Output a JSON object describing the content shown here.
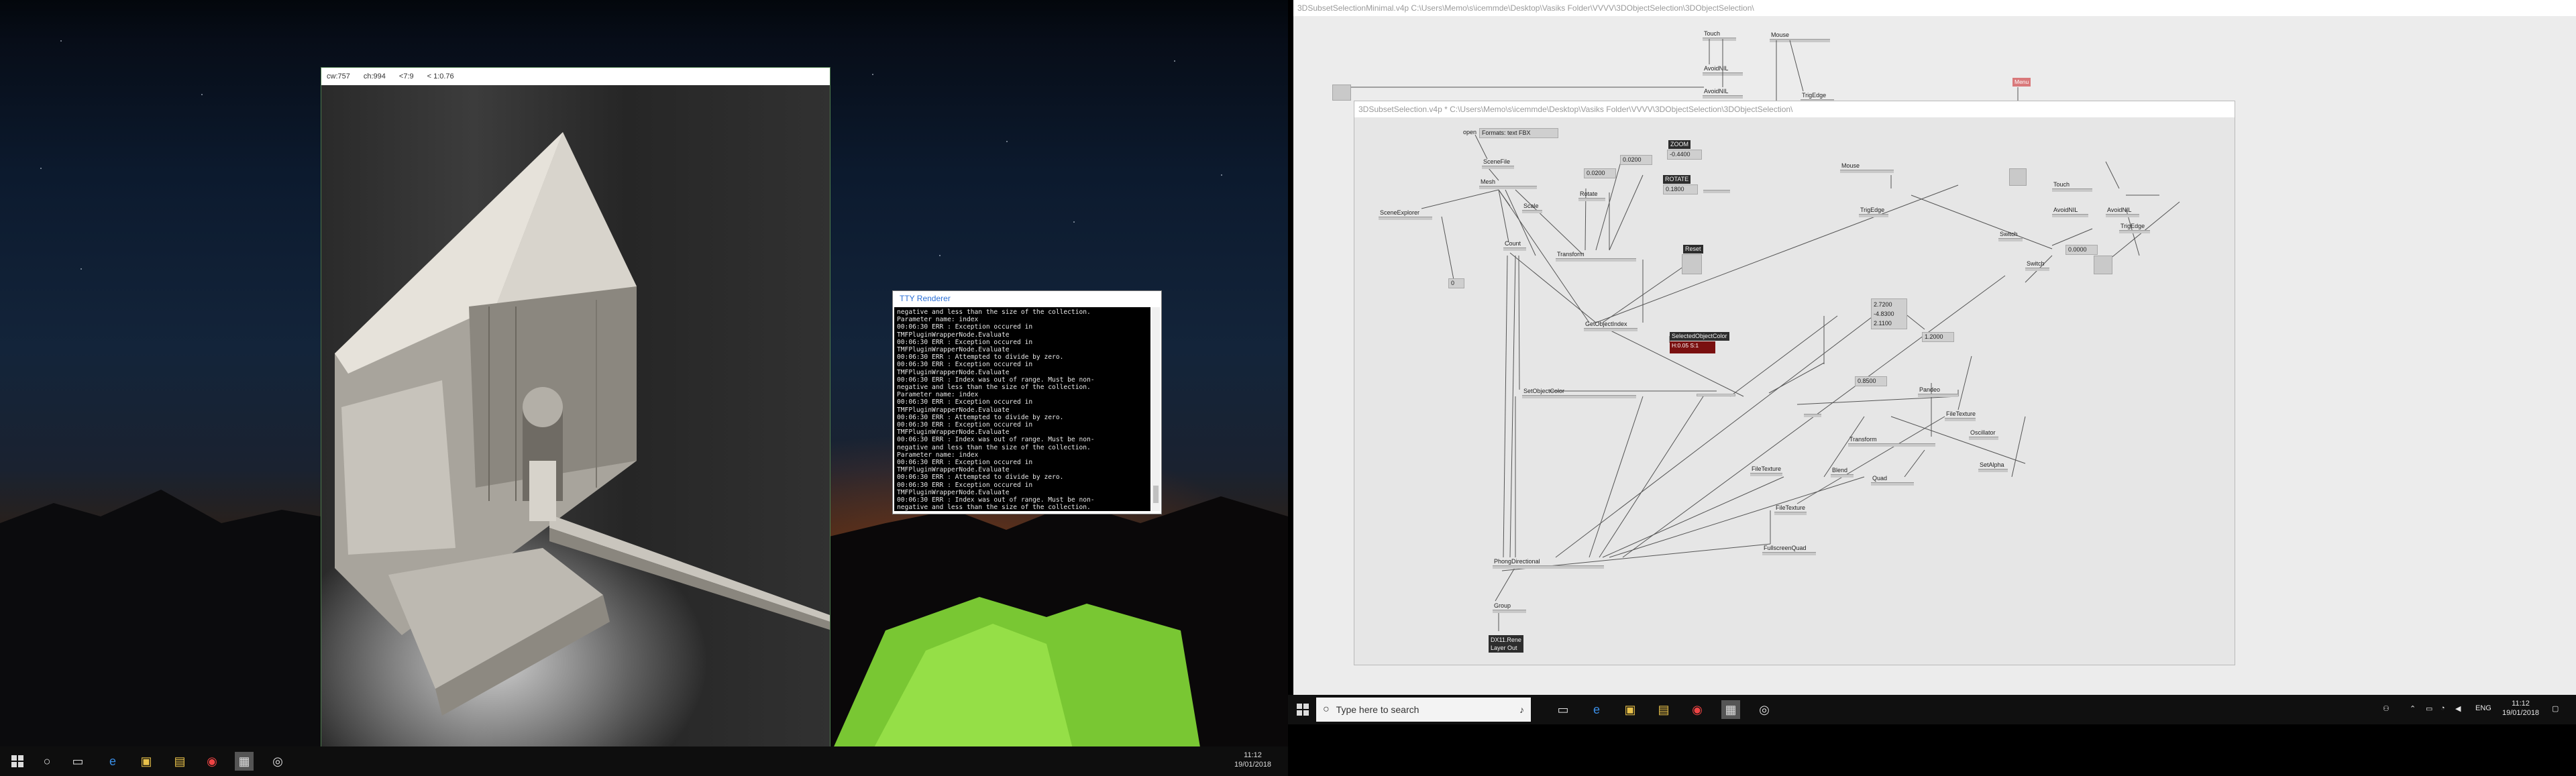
{
  "left_monitor": {
    "renderer": {
      "title_fields": [
        "cw:757",
        "ch:994",
        "<7:9",
        "< 1:0.76"
      ]
    },
    "tty_window": {
      "title": "TTY Renderer",
      "log": "negative and less than the size of the collection.\nParameter name: index\n00:06:30 ERR : Exception occured in\nTMFPluginWrapperNode.Evaluate\n00:06:30 ERR : Exception occured in\nTMFPluginWrapperNode.Evaluate\n00:06:30 ERR : Attempted to divide by zero.\n00:06:30 ERR : Exception occured in\nTMFPluginWrapperNode.Evaluate\n00:06:30 ERR : Index was out of range. Must be non-\nnegative and less than the size of the collection.\nParameter name: index\n00:06:30 ERR : Exception occured in\nTMFPluginWrapperNode.Evaluate\n00:06:30 ERR : Attempted to divide by zero.\n00:06:30 ERR : Exception occured in\nTMFPluginWrapperNode.Evaluate\n00:06:30 ERR : Index was out of range. Must be non-\nnegative and less than the size of the collection.\nParameter name: index\n00:06:30 ERR : Exception occured in\nTMFPluginWrapperNode.Evaluate\n00:06:30 ERR : Attempted to divide by zero.\n00:06:30 ERR : Exception occured in\nTMFPluginWrapperNode.Evaluate\n00:06:30 ERR : Index was out of range. Must be non-\nnegative and less than the size of the collection.\nParameter name: index"
    },
    "taskbar": {
      "time": "11:12",
      "date": "19/01/2018"
    }
  },
  "right_monitor": {
    "outer_patch": {
      "title": "3DSubsetSelectionMinimal.v4p    C:\\Users\\Memo\\s\\icemmde\\Desktop\\Vasiks Folder\\VVVV\\3DObjectSelection\\3DObjectSelection\\"
    },
    "outer_nodes": {
      "touch": "Touch",
      "avoid_nil": "AvoidNIL",
      "mouse": "Mouse",
      "avoid_nil_2": "AvoidNIL",
      "trig_edge": "TrigEdge",
      "menu": "Menu"
    },
    "inner_patch": {
      "title": "3DSubsetSelection.v4p *   C:\\Users\\Memo\\s\\icemmde\\Desktop\\Vasiks Folder\\VVVV\\3DObjectSelection\\3DObjectSelection\\",
      "nodes": {
        "open": "open",
        "format": "Formats: text FBX",
        "scene_file": "SceneFile",
        "mesh": "Mesh",
        "scene_explorer": "SceneExplorer",
        "count": "Count",
        "zoom_label": "ZOOM",
        "zoom_value": "-0.4400",
        "rotate_label": "ROTATE",
        "rotate_value": "0.1800",
        "val_a": "0.0200",
        "val_b": "0.0200",
        "rotate_node": "Rotate",
        "scale_node": "Scale",
        "transform": "Transform",
        "reset": "Reset",
        "get_object_index": "GetObjectIndex",
        "selected_color_label": "SelectedObjectColor",
        "selected_color_value": "H:0.05  S:1",
        "set_object_color": "SetObjectColor",
        "phong_directional": "PhongDirectional",
        "group": "Group",
        "dx11_renderer": "DX11.Rene Layer Out",
        "mouse": "Mouse",
        "trig_edge": "TrigEdge",
        "touch": "Touch",
        "avoid_nil": "AvoidNIL",
        "avoid_nil_2": "AvoidNIL",
        "trig_edge_2": "TrigEdge",
        "switch_a": "Switch",
        "switch_b": "Switch",
        "val_c": "0.0000",
        "vec_x": "2.7200",
        "vec_y": "-4.8300",
        "vec_z": "2.1100",
        "val_d": "1.2000",
        "val_e": "0.8500",
        "pandeo": "Pandeo",
        "file_texture": "FileTexture",
        "transform_2": "Transform",
        "oscillator": "Oscillator",
        "blend": "Blend",
        "quad": "Quad",
        "set_alpha": "SetAlpha",
        "file_texture_2": "FileTexture",
        "file_texture_3": "FileTexture",
        "fullscreen_quad": "FullscreenQuad",
        "zero": "0"
      }
    },
    "taskbar": {
      "search_placeholder": "Type here to search",
      "lang": "ENG",
      "time": "11:12",
      "date": "19/01/2018"
    }
  },
  "colors": {
    "accent_blue": "#2a6fd6",
    "error_red": "#7a1010",
    "tent_green": "#8fe040"
  }
}
